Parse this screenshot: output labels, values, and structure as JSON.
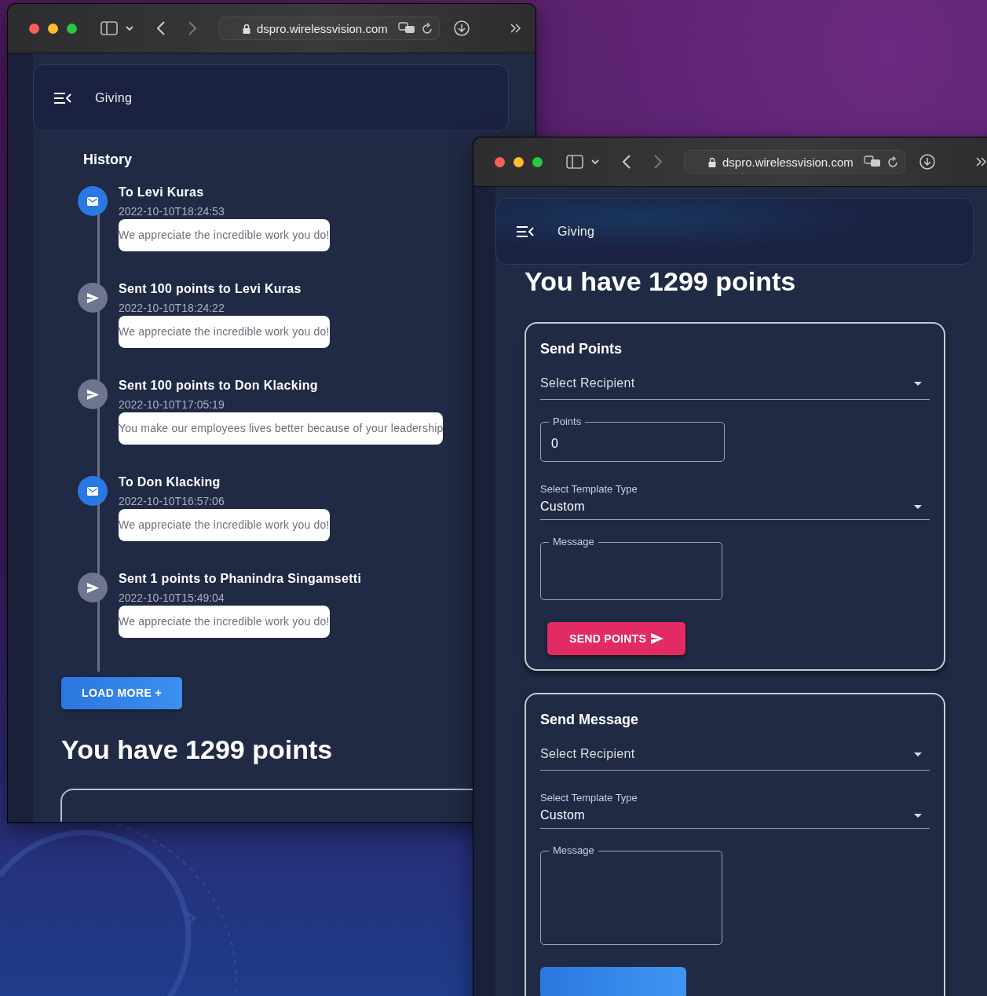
{
  "left_window": {
    "toolbar": {
      "url": "dspro.wirelessvision.com"
    },
    "header": {
      "title": "Giving"
    },
    "history": {
      "title": "History",
      "items": [
        {
          "kind": "message",
          "title": "To Levi Kuras",
          "time": "2022-10-10T18:24:53",
          "message": "We appreciate the incredible work you do!"
        },
        {
          "kind": "sent",
          "title": "Sent 100 points to Levi Kuras",
          "time": "2022-10-10T18:24:22",
          "message": "We appreciate the incredible work you do!"
        },
        {
          "kind": "sent",
          "title": "Sent 100 points to Don Klacking",
          "time": "2022-10-10T17:05:19",
          "message": "You make our employees lives better because of your leadership"
        },
        {
          "kind": "message",
          "title": "To Don Klacking",
          "time": "2022-10-10T16:57:06",
          "message": "We appreciate the incredible work you do!"
        },
        {
          "kind": "sent",
          "title": "Sent 1 points to Phanindra Singamsetti",
          "time": "2022-10-10T15:49:04",
          "message": "We appreciate the incredible work you do!"
        }
      ]
    },
    "load_more": "LOAD MORE +",
    "points_heading": "You have 1299 points"
  },
  "right_window": {
    "toolbar": {
      "url": "dspro.wirelessvision.com"
    },
    "header": {
      "title": "Giving"
    },
    "points_heading": "You have 1299 points",
    "send_points": {
      "title": "Send Points",
      "recipient": {
        "placeholder": "Select Recipient"
      },
      "points": {
        "label": "Points",
        "value": "0"
      },
      "template": {
        "label": "Select Template Type",
        "value": "Custom"
      },
      "message": {
        "label": "Message"
      },
      "button": "SEND POINTS"
    },
    "send_message": {
      "title": "Send Message",
      "recipient": {
        "placeholder": "Select Recipient"
      },
      "template": {
        "label": "Select Template Type",
        "value": "Custom"
      },
      "message": {
        "label": "Message"
      }
    }
  }
}
